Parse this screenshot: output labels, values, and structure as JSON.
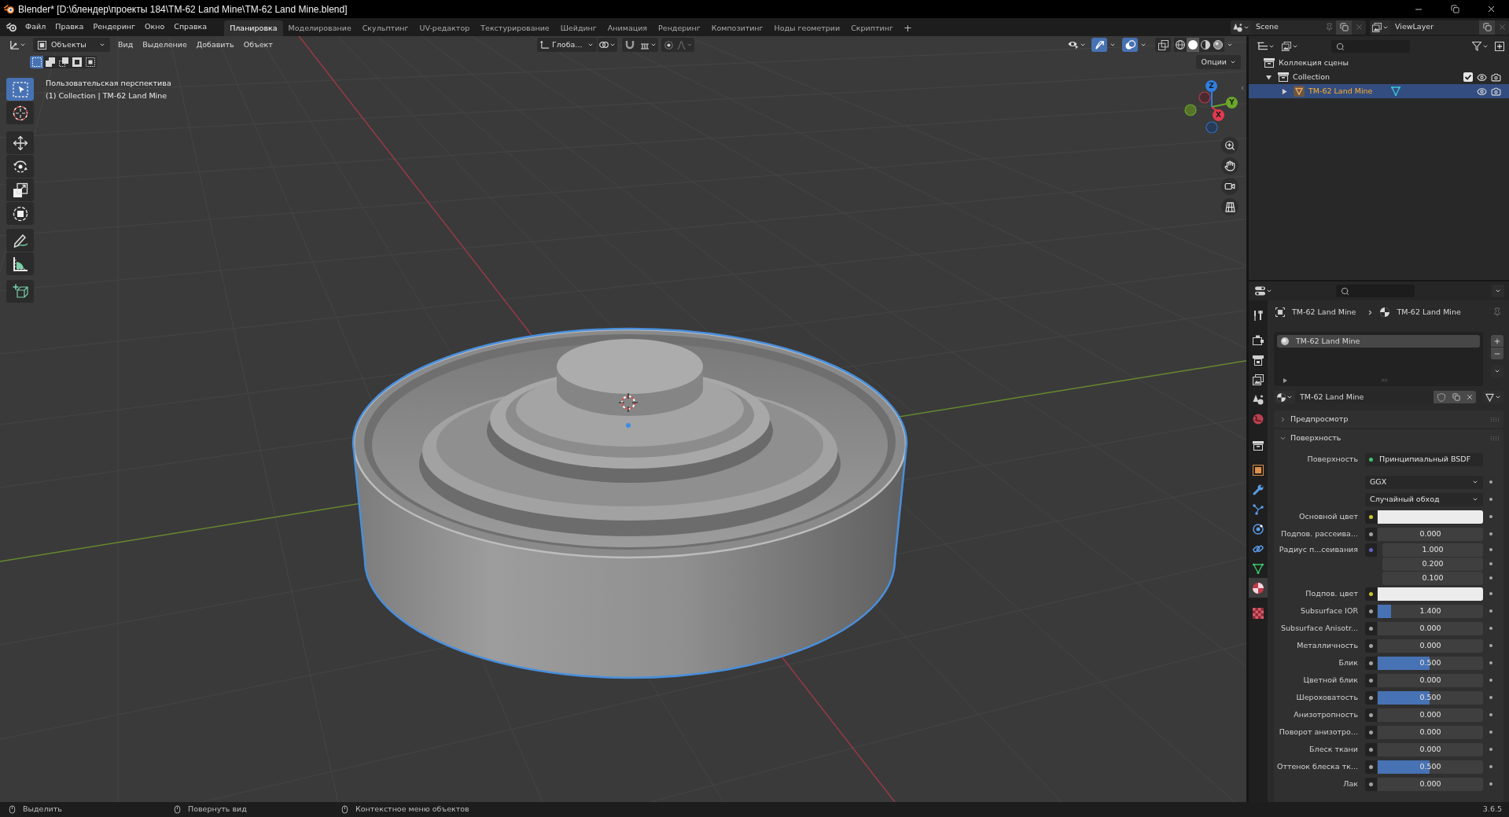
{
  "title_bar": {
    "title": "Blender* [D:\\блендер\\проекты 184\\TM-62 Land Mine\\TM-62 Land Mine.blend]"
  },
  "menu_bar": {
    "menus": [
      "Файл",
      "Правка",
      "Рендеринг",
      "Окно",
      "Справка"
    ],
    "workspaces": [
      {
        "label": "Планировка",
        "selected": true
      },
      {
        "label": "Моделирование",
        "selected": false
      },
      {
        "label": "Скульптинг",
        "selected": false
      },
      {
        "label": "UV-редактор",
        "selected": false
      },
      {
        "label": "Текстурирование",
        "selected": false
      },
      {
        "label": "Шейдинг",
        "selected": false
      },
      {
        "label": "Анимация",
        "selected": false
      },
      {
        "label": "Рендеринг",
        "selected": false
      },
      {
        "label": "Композитинг",
        "selected": false
      },
      {
        "label": "Ноды геометрии",
        "selected": false
      },
      {
        "label": "Скриптинг",
        "selected": false
      }
    ],
    "add_workspace": "+",
    "scene": "Scene",
    "view_layer": "ViewLayer"
  },
  "viewport": {
    "header": {
      "mode": "Объекты",
      "menus": [
        "Вид",
        "Выделение",
        "Добавить",
        "Объект"
      ],
      "orientation": "Глоба...",
      "toggles": [
        {
          "kind": "gizmos",
          "on": true
        },
        {
          "kind": "overlays",
          "on": true
        },
        {
          "kind": "xray",
          "on": false
        }
      ],
      "shading": [
        {
          "kind": "wireframe",
          "selected": false
        },
        {
          "kind": "solid",
          "selected": true
        },
        {
          "kind": "material",
          "selected": false
        },
        {
          "kind": "rendered",
          "selected": false
        }
      ]
    },
    "selection_modes": [
      {
        "kind": "set",
        "selected": true
      },
      {
        "kind": "extend",
        "selected": false
      },
      {
        "kind": "subtract",
        "selected": false
      },
      {
        "kind": "difference",
        "selected": false
      },
      {
        "kind": "intersect",
        "selected": false
      }
    ],
    "options": "Опции",
    "tools": [
      {
        "kind": "select_box",
        "selected": true
      },
      {
        "kind": "cursor",
        "selected": false
      },
      {
        "kind": "move",
        "selected": false
      },
      {
        "kind": "rotate",
        "selected": false
      },
      {
        "kind": "scale",
        "selected": false
      },
      {
        "kind": "transform",
        "selected": false
      },
      {
        "kind": "annotate",
        "selected": false
      },
      {
        "kind": "measure",
        "selected": false
      },
      {
        "kind": "add_cube",
        "selected": false
      }
    ],
    "info": [
      "Пользовательская перспектива",
      "(1) Collection | TM-62 Land Mine"
    ],
    "gizmo_axes": [
      {
        "label": "Z",
        "color": "#2e7fe0"
      },
      {
        "label": "Y",
        "color": "#6ba72a"
      },
      {
        "label": "X",
        "color": "#e23a4f"
      }
    ]
  },
  "outliner": {
    "tree": [
      {
        "kind": "scene_collection",
        "label": "Коллекция сцены",
        "selected": false,
        "children": [
          {
            "kind": "collection",
            "label": "Collection",
            "selected": false,
            "expanded": true,
            "checked": true,
            "children": [
              {
                "kind": "mesh_object",
                "label": "TM-62 Land Mine",
                "selected": true,
                "expanded": false
              }
            ]
          }
        ]
      }
    ]
  },
  "properties": {
    "tabs": [
      {
        "kind": "tool",
        "selected": false
      },
      {
        "kind": "render",
        "selected": false
      },
      {
        "kind": "output",
        "selected": false
      },
      {
        "kind": "view_layer",
        "selected": false
      },
      {
        "kind": "scene",
        "selected": false
      },
      {
        "kind": "world",
        "selected": false
      },
      {
        "kind": "collection",
        "selected": false
      },
      {
        "kind": "object",
        "selected": false
      },
      {
        "kind": "modifiers",
        "selected": false
      },
      {
        "kind": "particles",
        "selected": false
      },
      {
        "kind": "physics",
        "selected": false
      },
      {
        "kind": "constraints",
        "selected": false
      },
      {
        "kind": "data",
        "selected": false
      },
      {
        "kind": "material",
        "selected": true
      },
      {
        "kind": "texture",
        "selected": false
      }
    ],
    "breadcrumb": [
      "TM-62 Land Mine",
      "TM-62 Land Mine"
    ],
    "material_slots": [
      {
        "label": "TM-62 Land Mine",
        "selected": true
      }
    ],
    "material": "TM-62 Land Mine",
    "panels": [
      {
        "title": "Предпросмотр",
        "expanded": false
      },
      {
        "title": "Поверхность",
        "expanded": true,
        "rows": [
          {
            "kind": "shader",
            "label": "Поверхность",
            "value": "Принципиальный BSDF"
          },
          {
            "kind": "dropdown",
            "value": "GGX"
          },
          {
            "kind": "dropdown",
            "value": "Случайный обход"
          },
          {
            "kind": "color",
            "label": "Основной цвет",
            "color": "#ececec"
          },
          {
            "kind": "number",
            "label": "Подпов. рассеива...",
            "value": "0.000"
          },
          {
            "kind": "vector",
            "label": "Радиус п...сеивания",
            "values": [
              "1.000",
              "0.200",
              "0.100"
            ]
          },
          {
            "kind": "color",
            "label": "Подпов. цвет",
            "color": "#ececec"
          },
          {
            "kind": "slider",
            "label": "Subsurface IOR",
            "value": "1.400",
            "level": 0.13
          },
          {
            "kind": "number",
            "label": "Subsurface Anisotr...",
            "value": "0.000"
          },
          {
            "kind": "number",
            "label": "Металличность",
            "value": "0.000"
          },
          {
            "kind": "slider",
            "label": "Блик",
            "value": "0.500",
            "level": 0.49
          },
          {
            "kind": "number",
            "label": "Цветной блик",
            "value": "0.000"
          },
          {
            "kind": "slider",
            "label": "Шероховатость",
            "value": "0.500",
            "level": 0.49
          },
          {
            "kind": "number",
            "label": "Анизотропность",
            "value": "0.000"
          },
          {
            "kind": "number",
            "label": "Поворот анизотро...",
            "value": "0.000"
          },
          {
            "kind": "number",
            "label": "Блеск ткани",
            "value": "0.000"
          },
          {
            "kind": "slider",
            "label": "Оттенок блеска тк...",
            "value": "0.500",
            "level": 0.49
          },
          {
            "kind": "number",
            "label": "Лак",
            "value": "0.000"
          }
        ]
      }
    ]
  },
  "status_bar": {
    "hints": [
      "Выделить",
      "Повернуть вид",
      "Контекстное меню объектов"
    ],
    "version": "3.6.5"
  }
}
